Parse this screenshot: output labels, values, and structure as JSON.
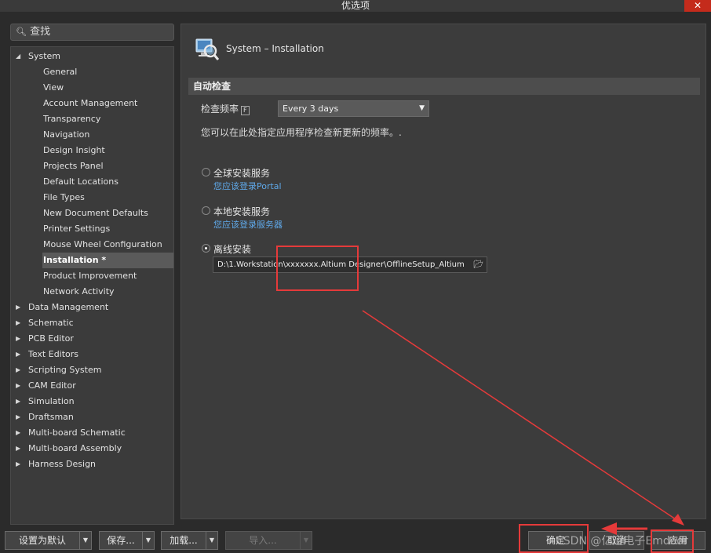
{
  "window": {
    "title": "优选项",
    "close": "✕"
  },
  "search": {
    "placeholder": "查找"
  },
  "tree": {
    "system": "System",
    "system_children": [
      "General",
      "View",
      "Account Management",
      "Transparency",
      "Navigation",
      "Design Insight",
      "Projects Panel",
      "Default Locations",
      "File Types",
      "New Document Defaults",
      "Printer Settings",
      "Mouse Wheel Configuration",
      "Installation *",
      "Product Improvement",
      "Network Activity"
    ],
    "selected": "Installation *",
    "groups": [
      "Data Management",
      "Schematic",
      "PCB Editor",
      "Text Editors",
      "Scripting System",
      "CAM Editor",
      "Simulation",
      "Draftsman",
      "Multi-board Schematic",
      "Multi-board Assembly",
      "Harness Design"
    ]
  },
  "main": {
    "header_title": "System – Installation",
    "section": "自动检查",
    "freq_label": "检查频率",
    "freq_hint_icon": "F",
    "freq_value": "Every 3 days",
    "description": "您可以在此处指定应用程序检查新更新的频率。.",
    "options": [
      {
        "label": "全球安装服务",
        "link": "您应该登录Portal",
        "checked": false
      },
      {
        "label": "本地安装服务",
        "link": "您应该登录服务器",
        "checked": false
      },
      {
        "label": "离线安装",
        "checked": true
      }
    ],
    "offline_path": "D:\\1.Workstation\\xxxxxxx.Altium Designer\\OfflineSetup_Altium"
  },
  "footer": {
    "set_default": "设置为默认",
    "save": "保存...",
    "load": "加载...",
    "import": "导入...",
    "ok": "确定",
    "cancel": "取消",
    "apply": "应用"
  },
  "watermark": "CSDN @亿道电子Emdoor",
  "annotation_color": "#e53a3a"
}
